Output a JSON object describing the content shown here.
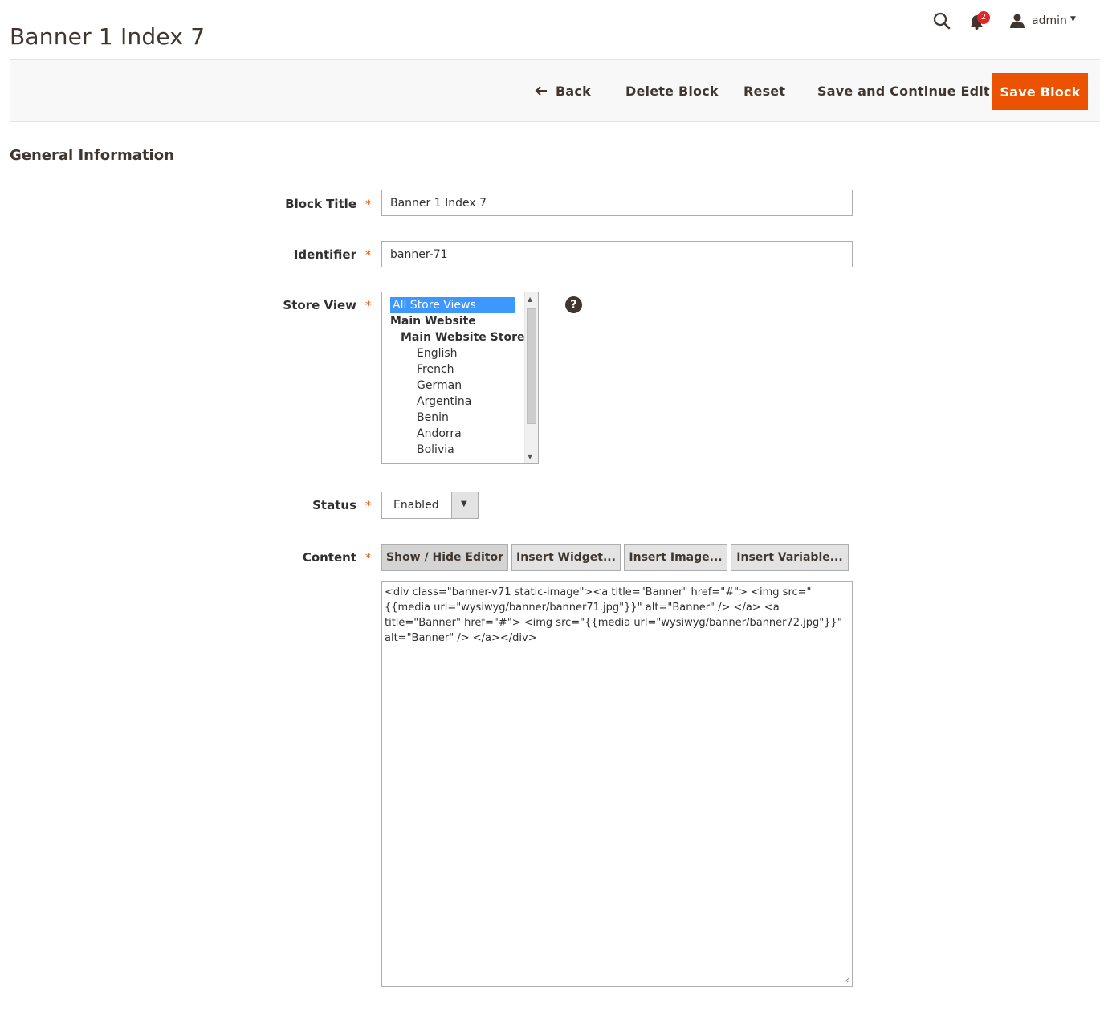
{
  "page": {
    "title": "Banner 1 Index 7"
  },
  "header": {
    "notifications_count": "2",
    "user_name": "admin"
  },
  "actions": {
    "back": "Back",
    "delete": "Delete Block",
    "reset": "Reset",
    "save_continue": "Save and Continue Edit",
    "save": "Save Block"
  },
  "section": {
    "title": "General Information"
  },
  "form": {
    "block_title": {
      "label": "Block Title",
      "value": "Banner 1 Index 7"
    },
    "identifier": {
      "label": "Identifier",
      "value": "banner-71"
    },
    "store_view": {
      "label": "Store View",
      "options": [
        {
          "label": "All Store Views",
          "level": 0,
          "selected": true,
          "bold": false
        },
        {
          "label": "Main Website",
          "level": 0,
          "selected": false,
          "bold": true
        },
        {
          "label": "Main Website Store",
          "level": 1,
          "selected": false,
          "bold": true
        },
        {
          "label": "English",
          "level": 2,
          "selected": false,
          "bold": false
        },
        {
          "label": "French",
          "level": 2,
          "selected": false,
          "bold": false
        },
        {
          "label": "German",
          "level": 2,
          "selected": false,
          "bold": false
        },
        {
          "label": "Argentina",
          "level": 2,
          "selected": false,
          "bold": false
        },
        {
          "label": "Benin",
          "level": 2,
          "selected": false,
          "bold": false
        },
        {
          "label": "Andorra",
          "level": 2,
          "selected": false,
          "bold": false
        },
        {
          "label": "Bolivia",
          "level": 2,
          "selected": false,
          "bold": false
        }
      ]
    },
    "status": {
      "label": "Status",
      "value": "Enabled"
    },
    "content": {
      "label": "Content",
      "buttons": {
        "show_hide": "Show / Hide Editor",
        "insert_widget": "Insert Widget...",
        "insert_image": "Insert Image...",
        "insert_variable": "Insert Variable..."
      },
      "value": "<div class=\"banner-v71 static-image\"><a title=\"Banner\" href=\"#\"> <img src=\"{{media url=\"wysiwyg/banner/banner71.jpg\"}}\" alt=\"Banner\" /> </a> <a title=\"Banner\" href=\"#\"> <img src=\"{{media url=\"wysiwyg/banner/banner72.jpg\"}}\" alt=\"Banner\" /> </a></div>"
    }
  },
  "colors": {
    "accent": "#eb5202",
    "selection": "#3c97ff",
    "badge": "#e22626"
  }
}
